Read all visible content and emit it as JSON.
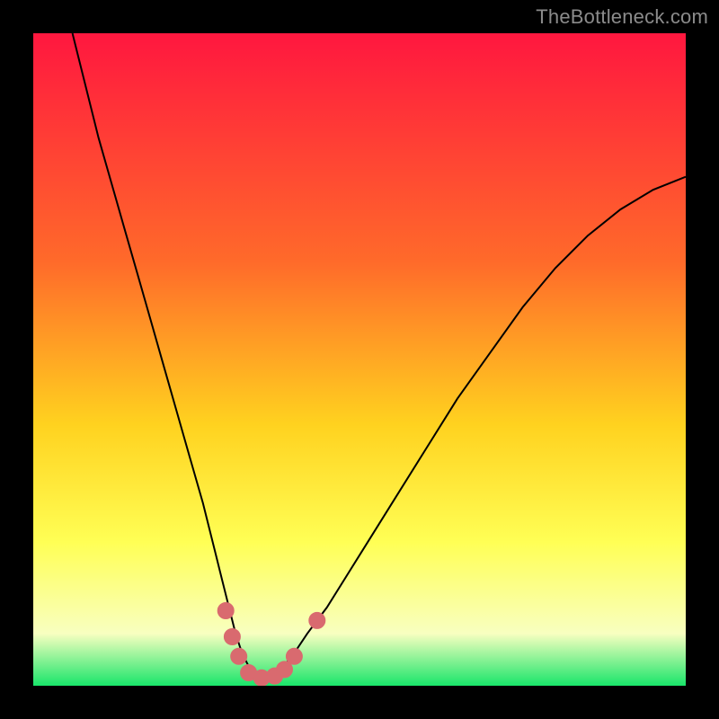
{
  "watermark": "TheBottleneck.com",
  "colors": {
    "background": "#000000",
    "gradient_top": "#ff173f",
    "gradient_mid1": "#ff6a2a",
    "gradient_mid2": "#ffd21f",
    "gradient_mid3": "#ffff55",
    "gradient_low": "#f8ffc0",
    "gradient_bottom": "#19e56a",
    "curve": "#000000",
    "marker_fill": "#d96a6f",
    "marker_stroke": "#d96a6f"
  },
  "chart_data": {
    "type": "line",
    "title": "",
    "xlabel": "",
    "ylabel": "",
    "xlim": [
      0,
      100
    ],
    "ylim": [
      0,
      100
    ],
    "series": [
      {
        "name": "bottleneck-curve",
        "x": [
          6,
          8,
          10,
          12,
          14,
          16,
          18,
          20,
          22,
          24,
          26,
          28,
          29,
          30,
          31,
          32,
          33,
          34,
          35,
          36,
          37,
          38,
          40,
          42,
          45,
          50,
          55,
          60,
          65,
          70,
          75,
          80,
          85,
          90,
          95,
          100
        ],
        "y": [
          100,
          92,
          84,
          77,
          70,
          63,
          56,
          49,
          42,
          35,
          28,
          20,
          16,
          12,
          8,
          5,
          3,
          1.5,
          1,
          1,
          1.5,
          2.5,
          5,
          8,
          12,
          20,
          28,
          36,
          44,
          51,
          58,
          64,
          69,
          73,
          76,
          78
        ]
      }
    ],
    "markers": [
      {
        "x": 29.5,
        "y": 11.5
      },
      {
        "x": 30.5,
        "y": 7.5
      },
      {
        "x": 31.5,
        "y": 4.5
      },
      {
        "x": 33.0,
        "y": 2.0
      },
      {
        "x": 35.0,
        "y": 1.2
      },
      {
        "x": 37.0,
        "y": 1.5
      },
      {
        "x": 38.5,
        "y": 2.5
      },
      {
        "x": 40.0,
        "y": 4.5
      },
      {
        "x": 43.5,
        "y": 10.0
      }
    ],
    "marker_radius_px": 9
  }
}
